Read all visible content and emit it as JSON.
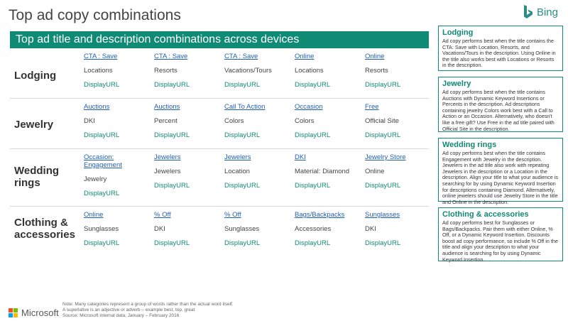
{
  "title": "Top ad copy combinations",
  "brand": {
    "name": "Bing",
    "accent": "#0f8a74",
    "link_color": "#1f5fb8"
  },
  "banner": "Top ad title and description combinations across devices",
  "categories": [
    {
      "label": "Lodging",
      "cols": [
        [
          "CTA : Save",
          "Locations",
          "DisplayURL"
        ],
        [
          "CTA : Save",
          "Resorts",
          "DisplayURL"
        ],
        [
          "CTA : Save",
          "Vacations/Tours",
          "DisplayURL"
        ],
        [
          "Online",
          "Locations",
          "DisplayURL"
        ],
        [
          "Online",
          "Resorts",
          "DisplayURL"
        ]
      ]
    },
    {
      "label": "Jewelry",
      "cols": [
        [
          "Auctions",
          "DKI",
          "DisplayURL"
        ],
        [
          "Auctions",
          "Percent",
          "DisplayURL"
        ],
        [
          "Call To Action",
          "Colors",
          "DisplayURL"
        ],
        [
          "Occasion",
          "Colors",
          "DisplayURL"
        ],
        [
          "Free",
          "Official Site",
          "DisplayURL"
        ]
      ]
    },
    {
      "label": "Wedding rings",
      "cols": [
        [
          "Occasion: Engagement",
          "Jewelry",
          "DisplayURL"
        ],
        [
          "Jewelers",
          "Jewelers",
          "DisplayURL"
        ],
        [
          "Jewelers",
          "Location",
          "DisplayURL"
        ],
        [
          "DKI",
          "Material: Diamond",
          "DisplayURL"
        ],
        [
          "Jewelry Store",
          "Online",
          "DisplayURL"
        ]
      ]
    },
    {
      "label": "Clothing & accessories",
      "cols": [
        [
          "Online",
          "Sunglasses",
          "DisplayURL"
        ],
        [
          "% Off",
          "DKI",
          "DisplayURL"
        ],
        [
          "% Off",
          "Sunglasses",
          "DisplayURL"
        ],
        [
          "Bags/Backpacks",
          "Accessories",
          "DisplayURL"
        ],
        [
          "Sunglasses",
          "DKI",
          "DisplayURL"
        ]
      ]
    }
  ],
  "sidebar": [
    {
      "heading": "Lodging",
      "text": "Ad copy performs best when the title contains the CTA: Save with Location, Resorts, and Vacations/Tours in the description. Using Online in the title also works best with Locations or Resorts in the description."
    },
    {
      "heading": "Jewelry",
      "text": "Ad copy performs best when the title contains Auctions with Dynamic Keyword Insertions or Percents in the description. Ad descriptions containing jewelry Colors work best with a Call to Action or an Occasion. Alternatively, who doesn't like a free gift? Use Free in the ad title paired with Official Site in the description."
    },
    {
      "heading": "Wedding rings",
      "text": "Ad copy performs best when the title contains Engagement with Jewelry in the description. Jewelers in the ad title also work with repeating Jewelers in the description or a Location in the description. Align your title to what your audience is searching for by using Dynamic Keyword Insertion for descriptions containing Diamond. Alternatively, online jewelers should use Jewelry Store in the title and Online in the description."
    },
    {
      "heading": "Clothing & accessories",
      "text": "Ad copy performs best for Sunglasses or Bags/Backpacks. Pair them with either Online, % Off, or a Dynamic Keyword Insertion. Discounts boost ad copy performance, so include % Off in the title and align your description to what your audience is searching for by using Dynamic Keyword Insertion."
    }
  ],
  "footer": {
    "microsoft": "Microsoft",
    "note1": "Note: Many categories represent a group of words rather than the actual word itself.",
    "note2": "A superlative is an adjective or adverb – example best, top, great",
    "note3": "Source: Microsoft internal data, January – February 2016"
  }
}
